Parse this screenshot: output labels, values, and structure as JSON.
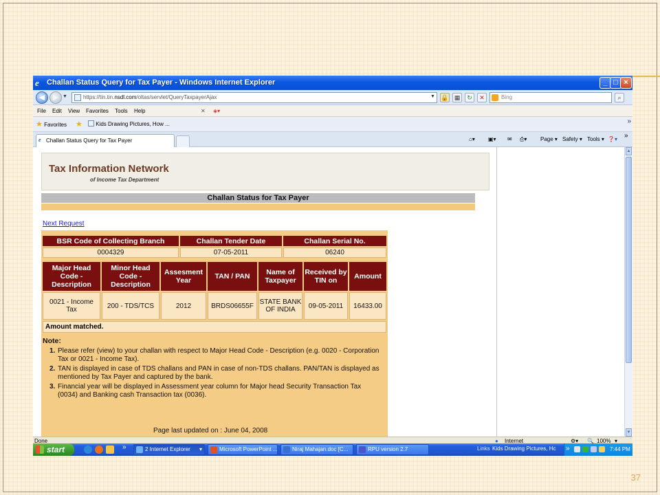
{
  "slide": {
    "page_number": "37"
  },
  "window": {
    "title": "Challan Status Query for Tax Payer - Windows Internet Explorer",
    "controls": [
      "_",
      "□",
      "×"
    ]
  },
  "address": {
    "url_prefix": "https://tin.tin.",
    "url_host": "nsdl.com",
    "url_path": "/oltas/servlet/QueryTaxpayerAjax",
    "search_placeholder": "Bing"
  },
  "menu": {
    "items": [
      "File",
      "Edit",
      "View",
      "Favorites",
      "Tools",
      "Help"
    ]
  },
  "favorites": {
    "label": "Favorites",
    "link": "Kids Drawing Pictures, How ..."
  },
  "tab": {
    "title": "Challan Status Query for Tax Payer"
  },
  "commandbar": {
    "page": "Page",
    "safety": "Safety",
    "tools": "Tools"
  },
  "page": {
    "site_title": "Tax Information Network",
    "site_subtitle": "of Income Tax Department",
    "heading": "Challan Status for Tax Payer",
    "next_request": "Next Request",
    "summary_headers": [
      "BSR Code of Collecting Branch",
      "Challan Tender Date",
      "Challan Serial No."
    ],
    "summary_values": [
      "0004329",
      "07-05-2011",
      "06240"
    ],
    "detail_headers": [
      "Major Head Code - Description",
      "Minor Head Code - Description",
      "Assesment Year",
      "TAN / PAN",
      "Name of Taxpayer",
      "Received by TIN on",
      "Amount"
    ],
    "detail_values": [
      "0021 - Income Tax",
      "200 - TDS/TCS",
      "2012",
      "BRDS06655F",
      "STATE BANK OF INDIA",
      "09-05-2011",
      "16433.00"
    ],
    "matched": "Amount matched.",
    "note_title": "Note:",
    "notes": [
      "Please refer (view) to your challan with respect to Major Head Code - Description (e.g. 0020 - Corporation Tax or 0021 - Income Tax).",
      "TAN is displayed in case of TDS challans and PAN in case of non-TDS challans. PAN/TAN is displayed as mentioned by Tax Payer and captured by the bank.",
      "Financial year will be displayed in Assessment year column for Major head Security Transaction Tax (0034) and Banking cash Transaction tax (0036)."
    ],
    "last_updated": "Page last updated on : June 04, 2008"
  },
  "statusbar": {
    "left": "Done",
    "zone": "Internet",
    "zoom": "100%"
  },
  "taskbar": {
    "start": "start",
    "tasks": [
      "2 Internet Explorer",
      "Microsoft PowerPoint ...",
      "Niraj Mahajan.doc [C...",
      "RPU version 2.7"
    ],
    "links_label": "Links",
    "links_item": "Kids Drawing Pictures, Hc",
    "clock": "7:44 PM"
  }
}
